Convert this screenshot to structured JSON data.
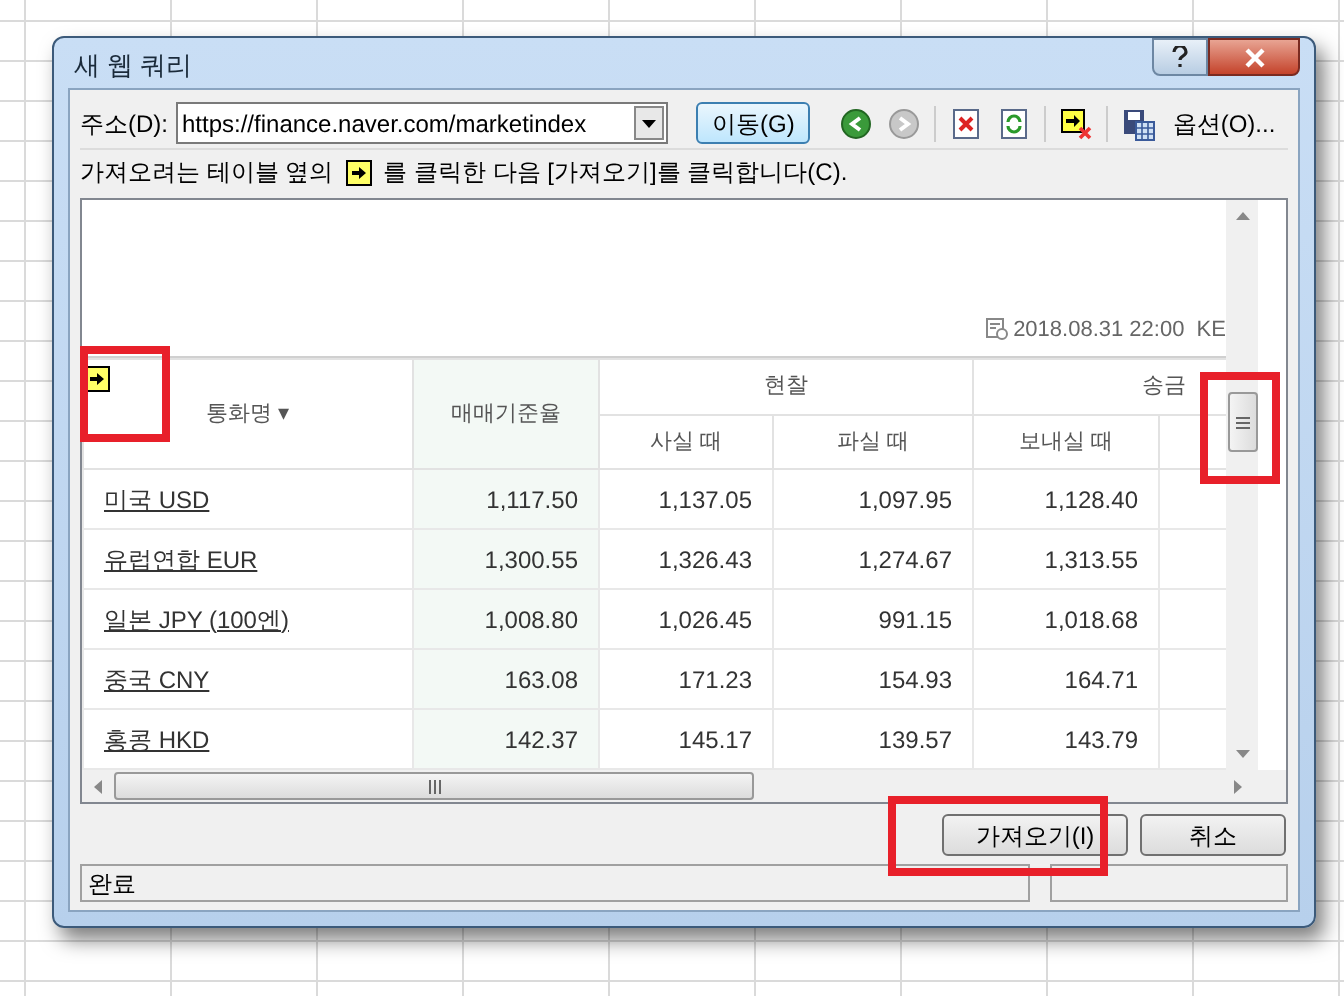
{
  "window": {
    "title": "새 웹 쿼리"
  },
  "address": {
    "label": "주소(D):",
    "value": "https://finance.naver.com/marketindex"
  },
  "go_button": "이동(G)",
  "options_button": "옵션(O)...",
  "instruction": {
    "before": "가져오려는 테이블 옆의",
    "after": "를 클릭한 다음 [가져오기]를 클릭합니다(C)."
  },
  "page": {
    "timestamp": "2018.08.31 22:00  KE",
    "table": {
      "header_groups": [
        {
          "label": "통화명 ▾",
          "kind": "single"
        },
        {
          "label": "매매기준율",
          "kind": "single"
        },
        {
          "label": "현찰",
          "kind": "group"
        },
        {
          "label": "송금",
          "kind": "group"
        }
      ],
      "subheaders": [
        "사실 때",
        "파실 때",
        "보내실 때"
      ],
      "rows": [
        {
          "name": "미국 USD",
          "values": [
            "1,117.50",
            "1,137.05",
            "1,097.95",
            "1,128.40"
          ]
        },
        {
          "name": "유럽연합 EUR",
          "values": [
            "1,300.55",
            "1,326.43",
            "1,274.67",
            "1,313.55"
          ]
        },
        {
          "name": "일본 JPY (100엔)",
          "values": [
            "1,008.80",
            "1,026.45",
            "991.15",
            "1,018.68"
          ]
        },
        {
          "name": "중국 CNY",
          "values": [
            "163.08",
            "171.23",
            "154.93",
            "164.71"
          ]
        },
        {
          "name": "홍콩 HKD",
          "values": [
            "142.37",
            "145.17",
            "139.57",
            "143.79"
          ]
        }
      ]
    }
  },
  "buttons": [
    "가져오기(I)",
    "취소"
  ],
  "status_bar": {
    "text": "완료"
  }
}
